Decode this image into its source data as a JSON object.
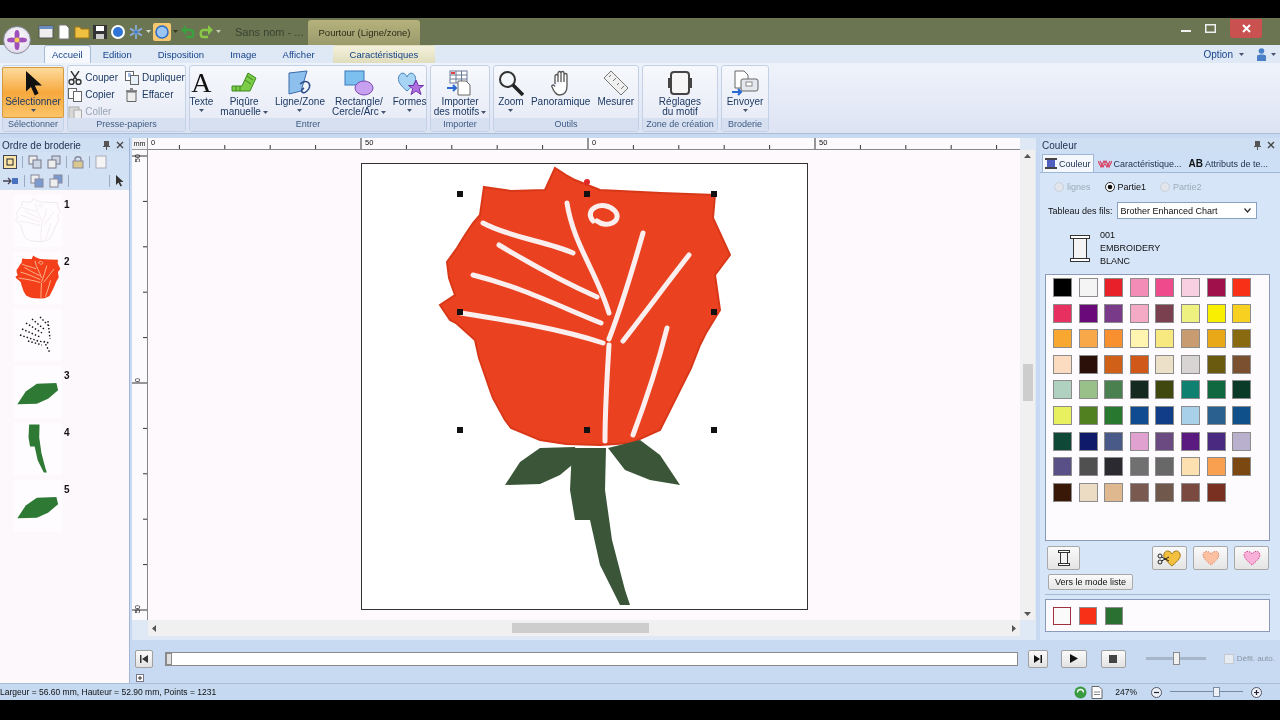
{
  "title_bar": {
    "document": "Sans nom - ...",
    "context_header": "Pourtour (Ligne/zone)"
  },
  "ribbon_tabs": [
    {
      "label": "Accueil",
      "selected": true,
      "contextual": false
    },
    {
      "label": "Edition",
      "selected": false,
      "contextual": false
    },
    {
      "label": "Disposition",
      "selected": false,
      "contextual": false
    },
    {
      "label": "Image",
      "selected": false,
      "contextual": false
    },
    {
      "label": "Afficher",
      "selected": false,
      "contextual": false
    },
    {
      "label": "Caractéristiques",
      "selected": false,
      "contextual": true
    }
  ],
  "ribbon_options": {
    "label": "Option"
  },
  "ribbon_groups": [
    {
      "label": "Sélectionner",
      "items": [
        {
          "kind": "large",
          "lines": [
            "Sélectionner"
          ],
          "dropdown": true,
          "active": true
        }
      ]
    },
    {
      "label": "Presse-papiers",
      "items": [
        {
          "kind": "small",
          "label": "Couper",
          "disabled": false
        },
        {
          "kind": "small",
          "label": "Copier",
          "disabled": false
        },
        {
          "kind": "small",
          "label": "Coller",
          "disabled": true
        },
        {
          "kind": "small",
          "label": "Dupliquer",
          "disabled": false
        },
        {
          "kind": "small",
          "label": "Effacer",
          "disabled": false
        }
      ]
    },
    {
      "label": "Entrer",
      "items": [
        {
          "kind": "large",
          "glyph": "A",
          "lines": [
            "Texte"
          ],
          "dropdown": true,
          "active": false
        },
        {
          "kind": "large",
          "lines": [
            "Piqûre",
            "manuelle"
          ],
          "dropdown": true,
          "active": false
        },
        {
          "kind": "large",
          "lines": [
            "Ligne/Zone"
          ],
          "dropdown": true,
          "active": false
        },
        {
          "kind": "large",
          "lines": [
            "Rectangle/",
            "Cercle/Arc"
          ],
          "dropdown": true,
          "active": false
        },
        {
          "kind": "large",
          "lines": [
            "Formes"
          ],
          "dropdown": true,
          "active": false
        }
      ]
    },
    {
      "label": "Importer",
      "items": [
        {
          "kind": "large",
          "lines": [
            "Importer",
            "des motifs"
          ],
          "dropdown": true,
          "active": false
        }
      ]
    },
    {
      "label": "Outils",
      "items": [
        {
          "kind": "large",
          "lines": [
            "Zoom"
          ],
          "dropdown": true,
          "active": false
        },
        {
          "kind": "large",
          "lines": [
            "Panoramique"
          ],
          "dropdown": false,
          "active": false
        },
        {
          "kind": "large",
          "lines": [
            "Mesurer"
          ],
          "dropdown": false,
          "active": false
        }
      ]
    },
    {
      "label": "Zone de création",
      "items": [
        {
          "kind": "large",
          "lines": [
            "Réglages",
            "du motif"
          ],
          "dropdown": false,
          "active": false
        }
      ]
    },
    {
      "label": "Broderie",
      "items": [
        {
          "kind": "large",
          "lines": [
            "Envoyer"
          ],
          "dropdown": true,
          "active": false
        }
      ]
    }
  ],
  "embroidery_order": {
    "title": "Ordre de broderie",
    "items": [
      {
        "number": "1",
        "kind": "outline"
      },
      {
        "number": "2",
        "kind": "bloom"
      },
      {
        "kind": "stitches"
      },
      {
        "number": "3",
        "kind": "leaf"
      },
      {
        "number": "4",
        "kind": "stem"
      },
      {
        "number": "5",
        "kind": "leaf"
      }
    ]
  },
  "canvas": {
    "unit": "mm",
    "top_ruler": [
      "0",
      "50",
      "0",
      "50"
    ],
    "left_ruler": [
      "50",
      "0",
      "50"
    ]
  },
  "color_panel": {
    "title": "Couleur",
    "tabs": [
      {
        "label": "Couleur",
        "selected": true
      },
      {
        "label": "Caractéristique...",
        "selected": false
      },
      {
        "badge": "AB",
        "label": "Attributs de te...",
        "selected": false
      }
    ],
    "radios": [
      {
        "label": "lignes",
        "selected": false,
        "disabled": true
      },
      {
        "label": "Partie1",
        "selected": true,
        "disabled": false
      },
      {
        "label": "Partie2",
        "selected": false,
        "disabled": true
      }
    ],
    "chart_label": "Tableau des fils:",
    "chart_value": "Brother Enhanced Chart",
    "thread": {
      "code": "001",
      "brand": "EMBROIDERY",
      "name": "BLANC"
    },
    "palette": [
      {
        "color": "#000000"
      },
      {
        "color": "#f4f4f4"
      },
      {
        "color": "#e8202a"
      },
      {
        "color": "#f48cb8"
      },
      {
        "color": "#ee4a8c"
      },
      {
        "color": "#f8cfe0"
      },
      {
        "color": "#a0104a"
      },
      {
        "color": "#f83018"
      },
      {
        "color": "#e83060"
      },
      {
        "color": "#6a0a7a"
      },
      {
        "color": "#7a3a8a"
      },
      {
        "color": "#f4aac4"
      },
      {
        "color": "#7a4050"
      },
      {
        "color": "#eef080"
      },
      {
        "color": "#f8f000"
      },
      {
        "color": "#f8d020"
      },
      {
        "color": "#f8a830"
      },
      {
        "color": "#f8a848"
      },
      {
        "color": "#f89030"
      },
      {
        "color": "#fff4b0"
      },
      {
        "color": "#f8e880"
      },
      {
        "color": "#c89c70"
      },
      {
        "color": "#e8a818"
      },
      {
        "color": "#8a6a10"
      },
      {
        "color": "#fcdcc0"
      },
      {
        "color": "#2a1008"
      },
      {
        "color": "#d06018"
      },
      {
        "color": "#d05818"
      },
      {
        "color": "#ece0c8"
      },
      {
        "color": "#d8d4d4"
      },
      {
        "color": "#6a5a10"
      },
      {
        "color": "#7a5030"
      },
      {
        "color": "#b0d0c0"
      },
      {
        "color": "#98c088"
      },
      {
        "color": "#4a8050"
      },
      {
        "color": "#142a20"
      },
      {
        "color": "#404810"
      },
      {
        "color": "#108070"
      },
      {
        "color": "#106840"
      },
      {
        "color": "#0a3a28"
      },
      {
        "color": "#e8f060"
      },
      {
        "color": "#508020"
      },
      {
        "color": "#287830"
      },
      {
        "color": "#104a90"
      },
      {
        "color": "#103c88"
      },
      {
        "color": "#a8d0e8"
      },
      {
        "color": "#2a6090"
      },
      {
        "color": "#10508a"
      },
      {
        "color": "#104838"
      },
      {
        "color": "#101a6a"
      },
      {
        "color": "#4a5a88"
      },
      {
        "color": "#e0a0d0"
      },
      {
        "color": "#6a4a80"
      },
      {
        "color": "#5a1a80"
      },
      {
        "color": "#4a2a80"
      },
      {
        "color": "#b8b0cc"
      },
      {
        "color": "#5a5088"
      },
      {
        "color": "#505050"
      },
      {
        "color": "#2a2a30"
      },
      {
        "color": "#707070"
      },
      {
        "color": "#686868"
      },
      {
        "color": "#fce0b0"
      },
      {
        "color": "#f8a050"
      },
      {
        "color": "#7a4810"
      },
      {
        "color": "#3a1808"
      },
      {
        "color": "#ecdcc4"
      },
      {
        "color": "#e0b890"
      },
      {
        "color": "#7a5a50"
      },
      {
        "color": "#70584c"
      },
      {
        "color": "#7a4a40"
      },
      {
        "color": "#7a3020"
      }
    ],
    "list_mode_button": "Vers le mode liste",
    "used_colors": [
      {
        "color": "#fafafa",
        "selected": true
      },
      {
        "color": "#f83018",
        "selected": false
      },
      {
        "color": "#2a7030",
        "selected": false
      }
    ]
  },
  "playback": {
    "progress": {
      "level": 0
    },
    "speed": {
      "level": 0.5
    },
    "auto_scroll": {
      "label": "Défil. auto.",
      "checked": false,
      "disabled": true
    }
  },
  "status_bar": {
    "text": "Largeur = 56.60 mm, Hauteur = 52.90 mm, Points = 1231",
    "zoom": "247%",
    "zoom_slider": {
      "level": 0.63
    }
  }
}
